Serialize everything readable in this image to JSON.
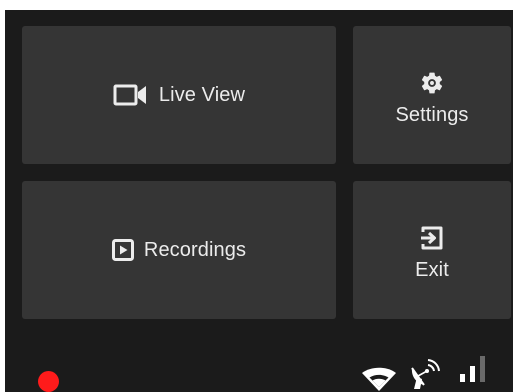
{
  "menu": {
    "live_view": {
      "label": "Live View",
      "icon": "videocam-icon"
    },
    "settings": {
      "label": "Settings",
      "icon": "gear-icon"
    },
    "recordings": {
      "label": "Recordings",
      "icon": "play-box-icon"
    },
    "exit": {
      "label": "Exit",
      "icon": "exit-icon"
    }
  },
  "status_bar": {
    "recording_indicator": {
      "state": "recording",
      "color": "#ff1b1b"
    },
    "wifi": {
      "icon": "wifi-icon"
    },
    "satellite": {
      "icon": "satellite-dish-icon"
    },
    "signal": {
      "icon": "signal-bars-icon",
      "bars_active": 2,
      "bars_total": 3
    }
  },
  "colors": {
    "background": "#1b1b1b",
    "tile": "#353535",
    "text": "#ececec",
    "inactive_bar": "#6a6a6a"
  }
}
